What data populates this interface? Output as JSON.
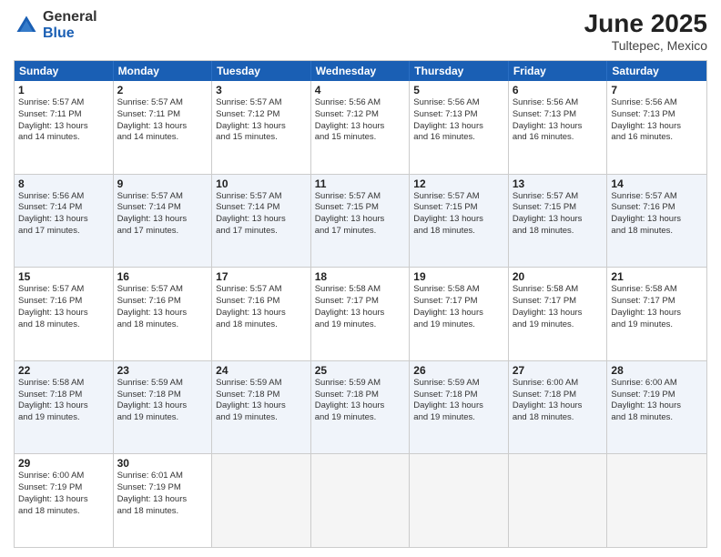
{
  "header": {
    "logo_general": "General",
    "logo_blue": "Blue",
    "main_title": "June 2025",
    "subtitle": "Tultepec, Mexico"
  },
  "calendar": {
    "days_of_week": [
      "Sunday",
      "Monday",
      "Tuesday",
      "Wednesday",
      "Thursday",
      "Friday",
      "Saturday"
    ],
    "weeks": [
      {
        "alt": false,
        "cells": [
          {
            "day": 1,
            "info": "Sunrise: 5:57 AM\nSunset: 7:11 PM\nDaylight: 13 hours\nand 14 minutes."
          },
          {
            "day": 2,
            "info": "Sunrise: 5:57 AM\nSunset: 7:11 PM\nDaylight: 13 hours\nand 14 minutes."
          },
          {
            "day": 3,
            "info": "Sunrise: 5:57 AM\nSunset: 7:12 PM\nDaylight: 13 hours\nand 15 minutes."
          },
          {
            "day": 4,
            "info": "Sunrise: 5:56 AM\nSunset: 7:12 PM\nDaylight: 13 hours\nand 15 minutes."
          },
          {
            "day": 5,
            "info": "Sunrise: 5:56 AM\nSunset: 7:13 PM\nDaylight: 13 hours\nand 16 minutes."
          },
          {
            "day": 6,
            "info": "Sunrise: 5:56 AM\nSunset: 7:13 PM\nDaylight: 13 hours\nand 16 minutes."
          },
          {
            "day": 7,
            "info": "Sunrise: 5:56 AM\nSunset: 7:13 PM\nDaylight: 13 hours\nand 16 minutes."
          }
        ]
      },
      {
        "alt": true,
        "cells": [
          {
            "day": 8,
            "info": "Sunrise: 5:56 AM\nSunset: 7:14 PM\nDaylight: 13 hours\nand 17 minutes."
          },
          {
            "day": 9,
            "info": "Sunrise: 5:57 AM\nSunset: 7:14 PM\nDaylight: 13 hours\nand 17 minutes."
          },
          {
            "day": 10,
            "info": "Sunrise: 5:57 AM\nSunset: 7:14 PM\nDaylight: 13 hours\nand 17 minutes."
          },
          {
            "day": 11,
            "info": "Sunrise: 5:57 AM\nSunset: 7:15 PM\nDaylight: 13 hours\nand 17 minutes."
          },
          {
            "day": 12,
            "info": "Sunrise: 5:57 AM\nSunset: 7:15 PM\nDaylight: 13 hours\nand 18 minutes."
          },
          {
            "day": 13,
            "info": "Sunrise: 5:57 AM\nSunset: 7:15 PM\nDaylight: 13 hours\nand 18 minutes."
          },
          {
            "day": 14,
            "info": "Sunrise: 5:57 AM\nSunset: 7:16 PM\nDaylight: 13 hours\nand 18 minutes."
          }
        ]
      },
      {
        "alt": false,
        "cells": [
          {
            "day": 15,
            "info": "Sunrise: 5:57 AM\nSunset: 7:16 PM\nDaylight: 13 hours\nand 18 minutes."
          },
          {
            "day": 16,
            "info": "Sunrise: 5:57 AM\nSunset: 7:16 PM\nDaylight: 13 hours\nand 18 minutes."
          },
          {
            "day": 17,
            "info": "Sunrise: 5:57 AM\nSunset: 7:16 PM\nDaylight: 13 hours\nand 18 minutes."
          },
          {
            "day": 18,
            "info": "Sunrise: 5:58 AM\nSunset: 7:17 PM\nDaylight: 13 hours\nand 19 minutes."
          },
          {
            "day": 19,
            "info": "Sunrise: 5:58 AM\nSunset: 7:17 PM\nDaylight: 13 hours\nand 19 minutes."
          },
          {
            "day": 20,
            "info": "Sunrise: 5:58 AM\nSunset: 7:17 PM\nDaylight: 13 hours\nand 19 minutes."
          },
          {
            "day": 21,
            "info": "Sunrise: 5:58 AM\nSunset: 7:17 PM\nDaylight: 13 hours\nand 19 minutes."
          }
        ]
      },
      {
        "alt": true,
        "cells": [
          {
            "day": 22,
            "info": "Sunrise: 5:58 AM\nSunset: 7:18 PM\nDaylight: 13 hours\nand 19 minutes."
          },
          {
            "day": 23,
            "info": "Sunrise: 5:59 AM\nSunset: 7:18 PM\nDaylight: 13 hours\nand 19 minutes."
          },
          {
            "day": 24,
            "info": "Sunrise: 5:59 AM\nSunset: 7:18 PM\nDaylight: 13 hours\nand 19 minutes."
          },
          {
            "day": 25,
            "info": "Sunrise: 5:59 AM\nSunset: 7:18 PM\nDaylight: 13 hours\nand 19 minutes."
          },
          {
            "day": 26,
            "info": "Sunrise: 5:59 AM\nSunset: 7:18 PM\nDaylight: 13 hours\nand 19 minutes."
          },
          {
            "day": 27,
            "info": "Sunrise: 6:00 AM\nSunset: 7:18 PM\nDaylight: 13 hours\nand 18 minutes."
          },
          {
            "day": 28,
            "info": "Sunrise: 6:00 AM\nSunset: 7:19 PM\nDaylight: 13 hours\nand 18 minutes."
          }
        ]
      },
      {
        "alt": false,
        "cells": [
          {
            "day": 29,
            "info": "Sunrise: 6:00 AM\nSunset: 7:19 PM\nDaylight: 13 hours\nand 18 minutes."
          },
          {
            "day": 30,
            "info": "Sunrise: 6:01 AM\nSunset: 7:19 PM\nDaylight: 13 hours\nand 18 minutes."
          },
          {
            "day": null,
            "info": ""
          },
          {
            "day": null,
            "info": ""
          },
          {
            "day": null,
            "info": ""
          },
          {
            "day": null,
            "info": ""
          },
          {
            "day": null,
            "info": ""
          }
        ]
      }
    ]
  }
}
